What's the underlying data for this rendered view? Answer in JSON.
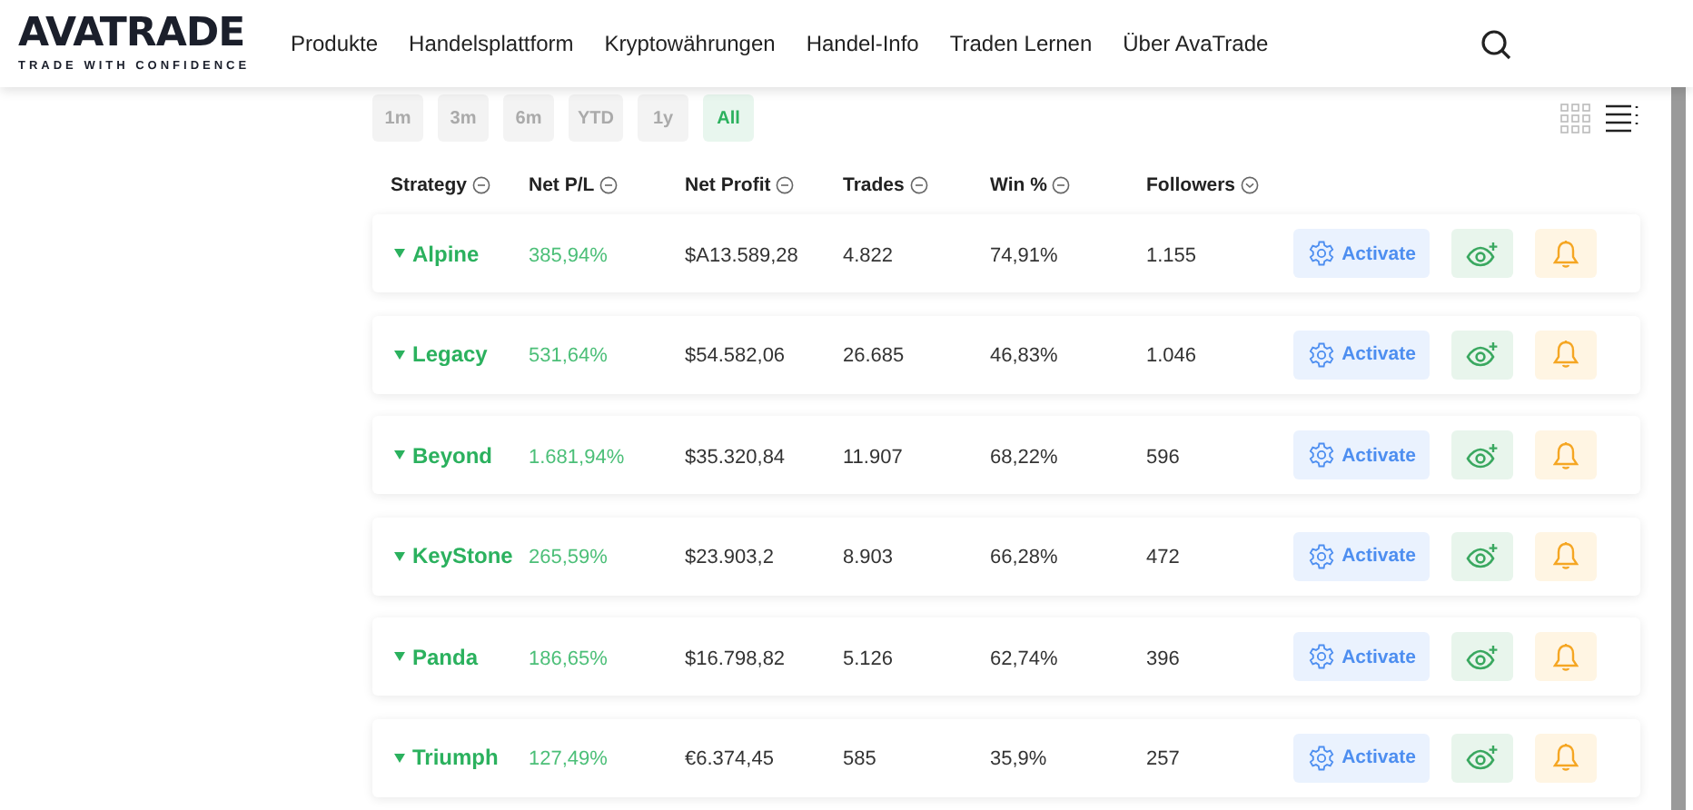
{
  "logo": {
    "name": "AVATRADE",
    "tagline": "TRADE WITH CONFIDENCE"
  },
  "nav": [
    "Produkte",
    "Handelsplattform",
    "Kryptowährungen",
    "Handel-Info",
    "Traden Lernen",
    "Über AvaTrade"
  ],
  "periods": [
    {
      "label": "1m",
      "selected": false
    },
    {
      "label": "3m",
      "selected": false
    },
    {
      "label": "6m",
      "selected": false
    },
    {
      "label": "YTD",
      "selected": false
    },
    {
      "label": "1y",
      "selected": false
    },
    {
      "label": "All",
      "selected": true
    }
  ],
  "view_toggle": [
    {
      "kind": "grid",
      "selected": false
    },
    {
      "kind": "list",
      "selected": true
    }
  ],
  "columns": [
    {
      "label": "Strategy",
      "sorted": false
    },
    {
      "label": "Net P/L",
      "sorted": false
    },
    {
      "label": "Net Profit",
      "sorted": false
    },
    {
      "label": "Trades",
      "sorted": false
    },
    {
      "label": "Win %",
      "sorted": false
    },
    {
      "label": "Followers",
      "sorted": true
    }
  ],
  "rows": [
    {
      "strategy": "Alpine",
      "net_pl": "385,94%",
      "net_profit": "$A13.589,28",
      "trades": "4.822",
      "win": "74,91%",
      "followers": "1.155",
      "action": "Activate"
    },
    {
      "strategy": "Legacy",
      "net_pl": "531,64%",
      "net_profit": "$54.582,06",
      "trades": "26.685",
      "win": "46,83%",
      "followers": "1.046",
      "action": "Activate"
    },
    {
      "strategy": "Beyond",
      "net_pl": "1.681,94%",
      "net_profit": "$35.320,84",
      "trades": "11.907",
      "win": "68,22%",
      "followers": "596",
      "action": "Activate"
    },
    {
      "strategy": "KeyStone",
      "net_pl": "265,59%",
      "net_profit": "$23.903,2",
      "trades": "8.903",
      "win": "66,28%",
      "followers": "472",
      "action": "Activate"
    },
    {
      "strategy": "Panda",
      "net_pl": "186,65%",
      "net_profit": "$16.798,82",
      "trades": "5.126",
      "win": "62,74%",
      "followers": "396",
      "action": "Activate"
    },
    {
      "strategy": "Triumph",
      "net_pl": "127,49%",
      "net_profit": "€6.374,45",
      "trades": "585",
      "win": "35,9%",
      "followers": "257",
      "action": "Activate"
    }
  ]
}
